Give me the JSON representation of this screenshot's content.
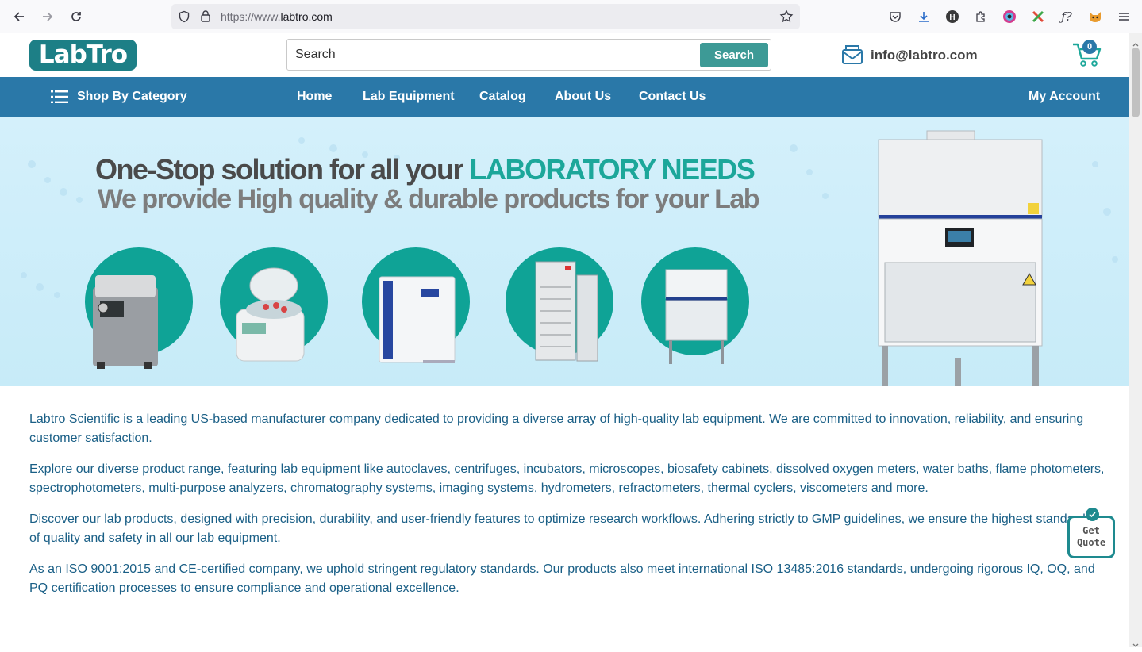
{
  "browser": {
    "url_protocol": "https://www.",
    "url_domain": "labtro.com",
    "back_icon": "arrow-left-icon",
    "forward_icon": "arrow-right-icon",
    "reload_icon": "reload-icon"
  },
  "header": {
    "logo_text": "LabTro",
    "search_placeholder": "Search",
    "search_button": "Search",
    "email": "info@labtro.com",
    "cart_count": "0"
  },
  "nav": {
    "category": "Shop By Category",
    "items": [
      "Home",
      "Lab Equipment",
      "Catalog",
      "About Us",
      "Contact Us"
    ],
    "account": "My Account"
  },
  "banner": {
    "headline_part1": "One-Stop solution for all your ",
    "headline_highlight": "LABORATORY NEEDS",
    "subheadline": "We provide High quality & durable products for your Lab",
    "products": [
      "autoclave",
      "centrifuge",
      "incubator",
      "refrigerator",
      "biosafety-cabinet"
    ]
  },
  "content": {
    "paragraphs": [
      "Labtro Scientific is a leading US-based manufacturer company dedicated to providing a diverse array of high-quality lab equipment. We are committed to innovation, reliability, and ensuring customer satisfaction.",
      "Explore our diverse product range, featuring lab equipment like autoclaves, centrifuges, incubators, microscopes, biosafety cabinets, dissolved oxygen meters, water baths, flame photometers, spectrophotometers, multi-purpose analyzers, chromatography systems, imaging systems, hydrometers, refractometers, thermal cyclers, viscometers and more.",
      "Discover our lab products, designed with precision, durability, and user-friendly features to optimize research workflows. Adhering strictly to GMP guidelines, we ensure the highest standards of quality and safety in all our lab equipment.",
      "As an ISO 9001:2015 and CE-certified company, we uphold stringent regulatory standards. Our products also meet international ISO 13485:2016 standards, undergoing rigorous IQ, OQ, and PQ certification processes to ensure compliance and operational excellence."
    ]
  },
  "quote": {
    "line1": "Get",
    "line2": "Quote"
  },
  "colors": {
    "nav": "#2a78a8",
    "brand": "#1d7f86",
    "accent": "#1ca79a",
    "text": "#1a5f86"
  }
}
